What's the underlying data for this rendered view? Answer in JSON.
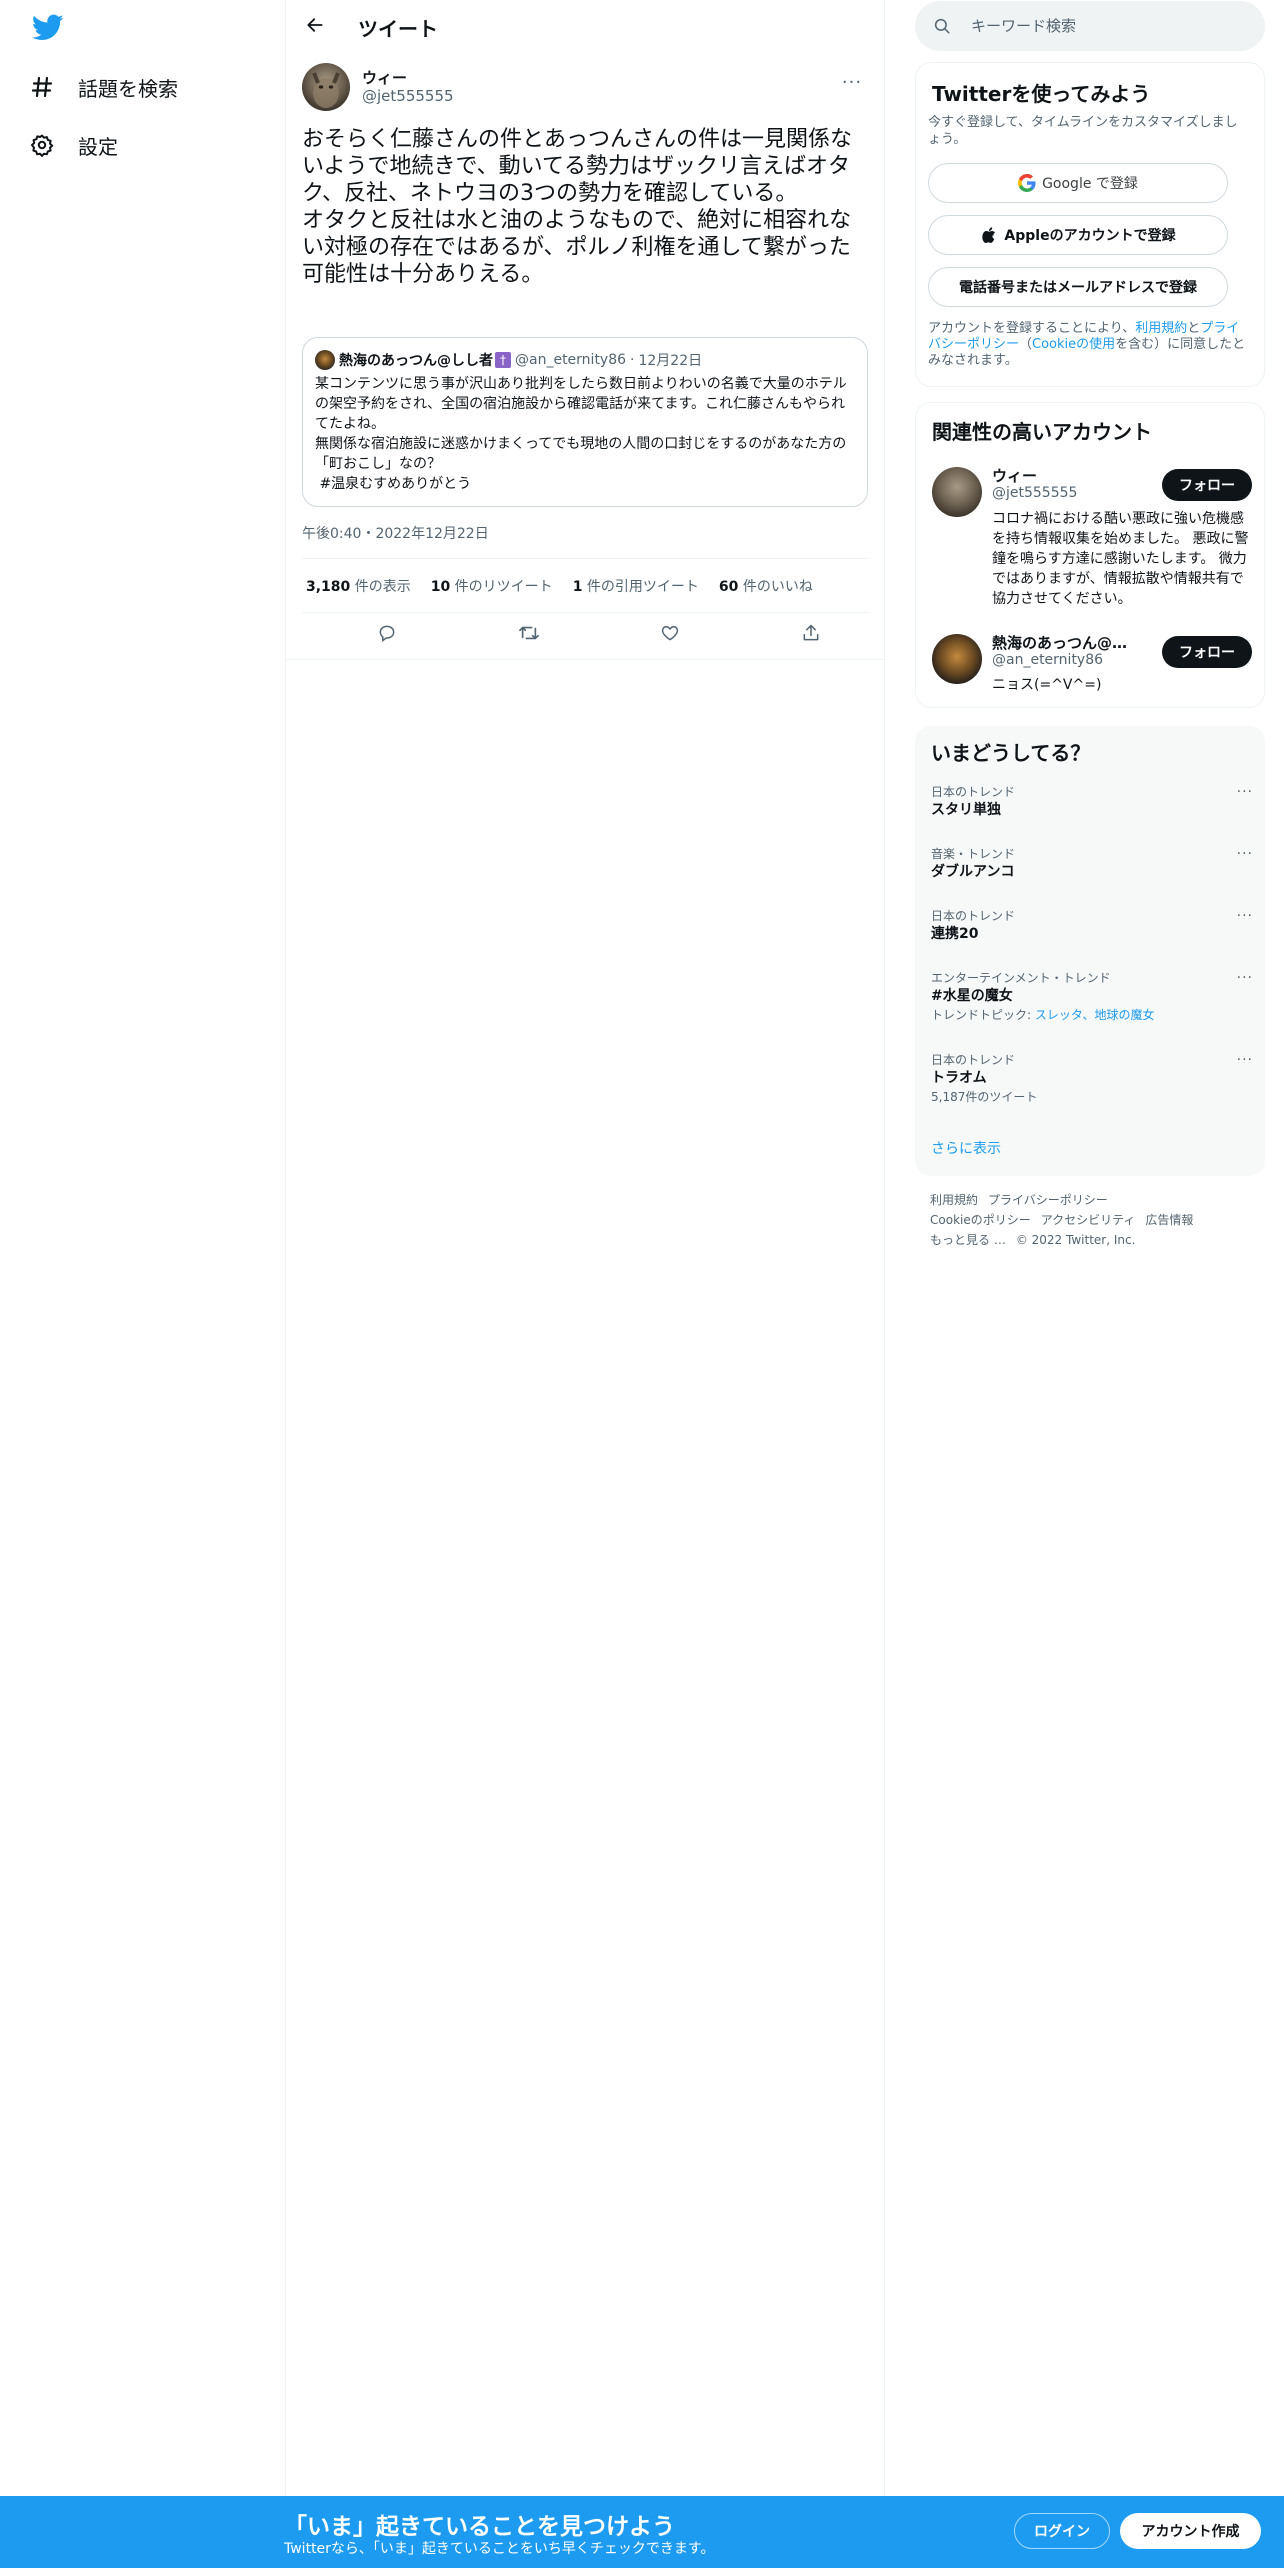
{
  "brand": {
    "accent": "#1d9bf0",
    "icon": "twitter-bird-icon"
  },
  "nav": {
    "explore": {
      "label": "話題を検索",
      "icon": "hashtag-icon"
    },
    "settings": {
      "label": "設定",
      "icon": "gear-icon"
    }
  },
  "header": {
    "title": "ツイート",
    "back_icon": "arrow-left-icon"
  },
  "tweet": {
    "author_name": "ウィー",
    "author_handle": "@jet555555",
    "more": "···",
    "text": "おそらく仁藤さんの件とあっつんさんの件は一見関係ないようで地続きで、動いてる勢力はザックリ言えばオタク、反社、ネトウヨの3つの勢力を確認している。\nオタクと反社は水と油のようなもので、絶対に相容れない対極の存在ではあるが、ポルノ利権を通して繋がった可能性は十分ありえる。",
    "quote": {
      "name": "熱海のあっつん@しし者",
      "badge": "†",
      "handle": "@an_eternity86",
      "dot": "·",
      "date": "12月22日",
      "text": "某コンテンツに思う事が沢山あり批判をしたら数日前よりわいの名義で大量のホテルの架空予約をされ、全国の宿泊施設から確認電話が来てます。これ仁藤さんもやられてたよね。\n無関係な宿泊施設に迷惑かけまくってでも現地の人間の口封じをするのがあなた方の「町おこし」なの？\n #温泉むすめありがとう"
    },
    "timestamp": "午後0:40・2022年12月22日",
    "stats": {
      "views_count": "3,180",
      "views_label": " 件の表示",
      "retweets_count": "10",
      "retweets_label": " 件のリツイート",
      "quotes_count": "1",
      "quotes_label": " 件の引用ツイート",
      "likes_count": "60",
      "likes_label": " 件のいいね"
    },
    "actions": [
      "reply-icon",
      "retweet-icon",
      "like-icon",
      "share-icon"
    ]
  },
  "search": {
    "placeholder": "キーワード検索",
    "icon": "search-icon"
  },
  "signup": {
    "title": "Twitterを使ってみよう",
    "subtitle": "今すぐ登録して、タイムラインをカスタマイズしましょう。",
    "google": "Google で登録",
    "apple": "Appleのアカウントで登録",
    "phone": "電話番号またはメールアドレスで登録",
    "legal_prefix": "アカウントを登録することにより、",
    "legal_terms": "利用規約",
    "legal_and": "と",
    "legal_privacy": "プライバシーポリシー",
    "legal_open": "（",
    "legal_cookie": "Cookieの使用",
    "legal_suffix": "を含む）に同意したとみなされます。"
  },
  "related": {
    "title": "関連性の高いアカウント",
    "accounts": [
      {
        "name": "ウィー",
        "handle": "@jet555555",
        "follow": "フォロー",
        "bio": "コロナ禍における酷い悪政に強い危機感を持ち情報収集を始めました。 悪政に警鐘を鳴らす方達に感謝いたします。 微力ではありますが、情報拡散や情報共有で協力させてください。"
      },
      {
        "name": "熱海のあっつん@しし者",
        "handle": "@an_eternity86",
        "follow": "フォロー",
        "bio": "ニョス(=^ᐯ^=)"
      }
    ]
  },
  "trends": {
    "title": "いまどうしてる？",
    "items": [
      {
        "meta": "日本のトレンド",
        "name": "スタリ単独",
        "more": "···"
      },
      {
        "meta": "音楽・トレンド",
        "name": "ダブルアンコ",
        "more": "···"
      },
      {
        "meta": "日本のトレンド",
        "name": "連携20",
        "more": "···"
      },
      {
        "meta": "エンターテインメント・トレンド",
        "name": "#水星の魔女",
        "sub_prefix": "トレンドトピック: ",
        "sub_links": "スレッタ、地球の魔女",
        "more": "···"
      },
      {
        "meta": "日本のトレンド",
        "name": "トラオム",
        "sub": "5,187件のツイート",
        "more": "···"
      }
    ],
    "show_more": "さらに表示"
  },
  "footer": {
    "terms": "利用規約",
    "privacy": "プライバシーポリシー",
    "cookie": "Cookieのポリシー",
    "accessibility": "アクセシビリティ",
    "ads": "広告情報",
    "more": "もっと見る …",
    "copyright": "© 2022 Twitter, Inc."
  },
  "bottom_bar": {
    "title": "「いま」起きていることを見つけよう",
    "subtitle": "Twitterなら、「いま」起きていることをいち早くチェックできます。",
    "login": "ログイン",
    "signup": "アカウント作成"
  }
}
